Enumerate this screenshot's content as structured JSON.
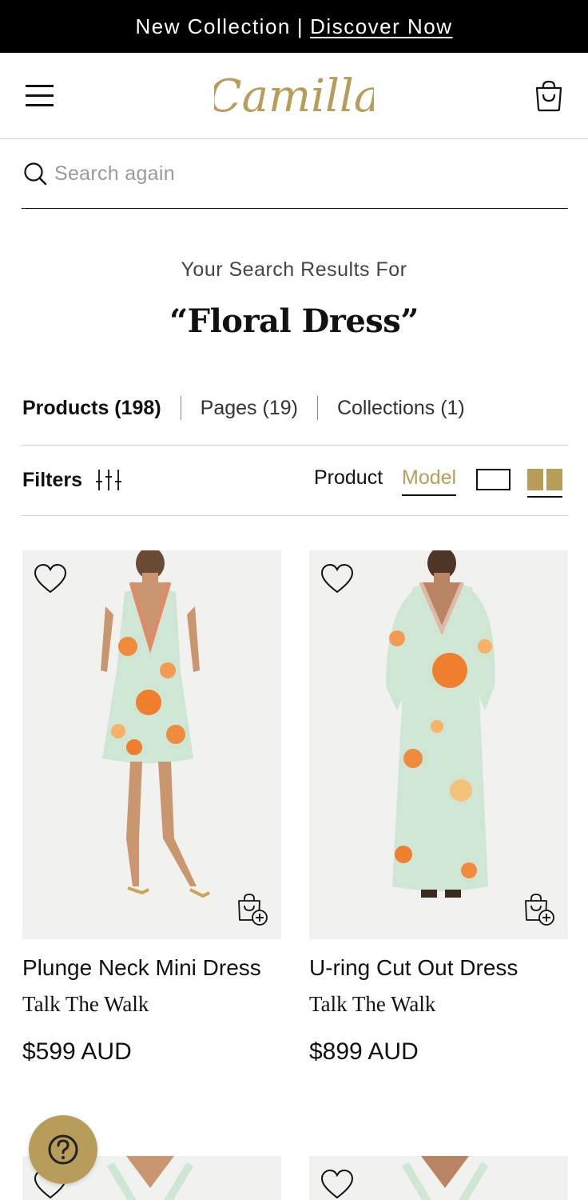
{
  "announcement": {
    "text": "New Collection",
    "separator": "|",
    "link_text": "Discover Now"
  },
  "header": {
    "logo_text": "Camilla",
    "brand_color": "#b79c5a",
    "menu_icon": "hamburger-menu-icon",
    "cart_icon": "shopping-bag-icon"
  },
  "search": {
    "placeholder": "Search again",
    "value": "",
    "icon": "search-icon"
  },
  "results": {
    "subtitle": "Your Search Results For",
    "term": "“Floral Dress”"
  },
  "tabs": [
    {
      "label": "Products (198)",
      "active": true
    },
    {
      "label": "Pages (19)",
      "active": false
    },
    {
      "label": "Collections (1)",
      "active": false
    }
  ],
  "toolbar": {
    "filters_label": "Filters",
    "view_product_label": "Product",
    "view_model_label": "Model",
    "active_view": "Model",
    "active_grid": "two-column",
    "accent_color": "#b79c5a"
  },
  "products": [
    {
      "name": "Plunge Neck Mini Dress",
      "collection": "Talk The Walk",
      "price": "$599 AUD"
    },
    {
      "name": "U-ring Cut Out Dress",
      "collection": "Talk The Walk",
      "price": "$899 AUD"
    },
    {
      "name": "",
      "collection": "",
      "price": ""
    },
    {
      "name": "",
      "collection": "",
      "price": ""
    }
  ],
  "help": {
    "icon": "question-mark-icon"
  }
}
